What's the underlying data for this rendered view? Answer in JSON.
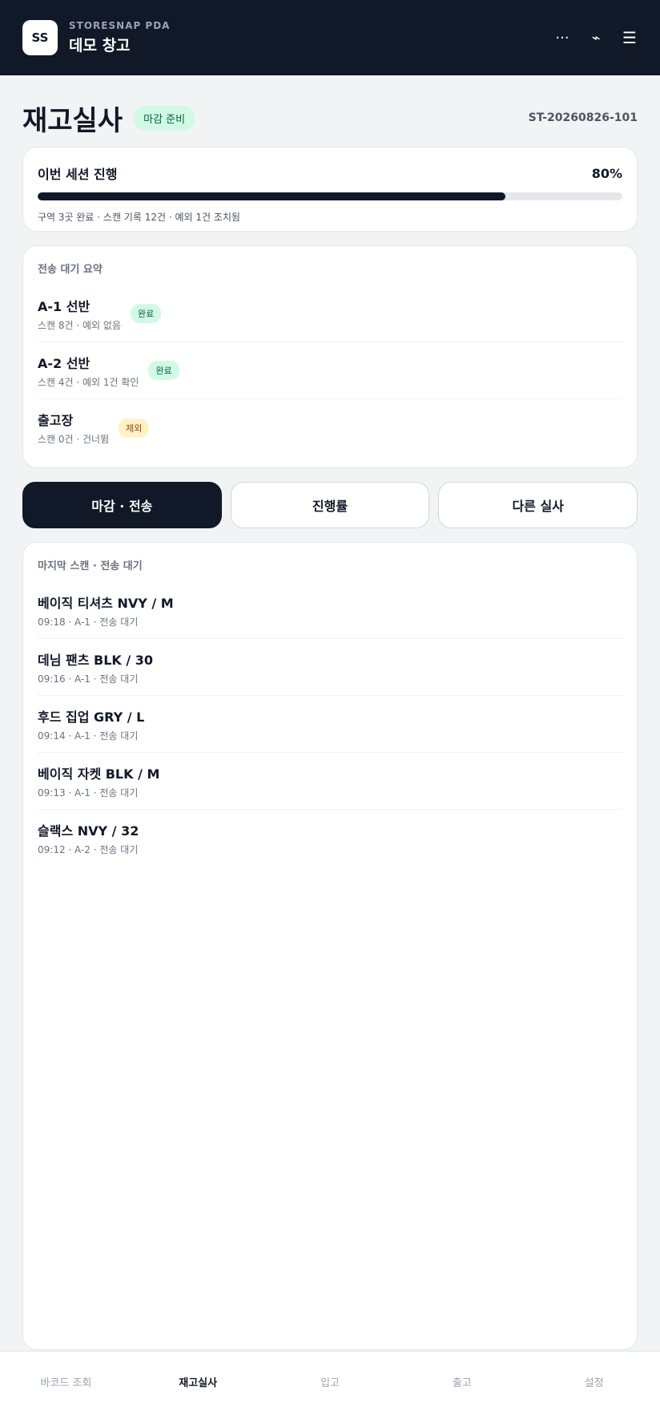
{
  "header": {
    "logo": "SS",
    "app_name": "STORESNAP PDA",
    "warehouse": "데모 창고",
    "icons": [
      "more-icon",
      "signal-icon",
      "menu-icon"
    ],
    "more_glyph": "···",
    "signal_glyph": "⌁",
    "menu_glyph": "☰"
  },
  "page": {
    "title": "재고실사",
    "status": "마감 준비",
    "session_id": "ST-20260826-101"
  },
  "progress": {
    "label": "이번 세션 진행",
    "percent_text": "80%",
    "percent": 80,
    "note": "구역 3곳 완료 · 스캔 기록 12건 · 예외 1건 조치됨"
  },
  "summary": {
    "label": "전송 대기 요약",
    "items": [
      {
        "name": "A-1 선반",
        "meta": "스캔 8건 · 예외 없음",
        "badge": "완료",
        "badge_type": "done"
      },
      {
        "name": "A-2 선반",
        "meta": "스캔 4건 · 예외 1건 확인",
        "badge": "완료",
        "badge_type": "done"
      },
      {
        "name": "출고장",
        "meta": "스캔 0건 · 건너뜀",
        "badge": "제외",
        "badge_type": "skip"
      }
    ]
  },
  "actions": {
    "close_send": "마감 · 전송",
    "progress": "진행률",
    "other_count": "다른 실사"
  },
  "scans": {
    "label": "마지막 스캔 · 전송 대기",
    "items": [
      {
        "name": "베이직 티셔츠 NVY / M",
        "meta": "09:18 · A-1 · 전송 대기"
      },
      {
        "name": "데님 팬츠 BLK / 30",
        "meta": "09:16 · A-1 · 전송 대기"
      },
      {
        "name": "후드 집업 GRY / L",
        "meta": "09:14 · A-1 · 전송 대기"
      },
      {
        "name": "베이직 자켓 BLK / M",
        "meta": "09:13 · A-1 · 전송 대기"
      },
      {
        "name": "슬랙스 NVY / 32",
        "meta": "09:12 · A-2 · 전송 대기"
      }
    ]
  },
  "tabs": [
    {
      "label": "바코드 조회",
      "active": false
    },
    {
      "label": "재고실사",
      "active": true
    },
    {
      "label": "입고",
      "active": false
    },
    {
      "label": "출고",
      "active": false
    },
    {
      "label": "설정",
      "active": false
    }
  ],
  "colors": {
    "header_bg": "#111827",
    "accent": "#111827",
    "done_badge": "#d1fae5",
    "skip_badge": "#fef3c7"
  }
}
